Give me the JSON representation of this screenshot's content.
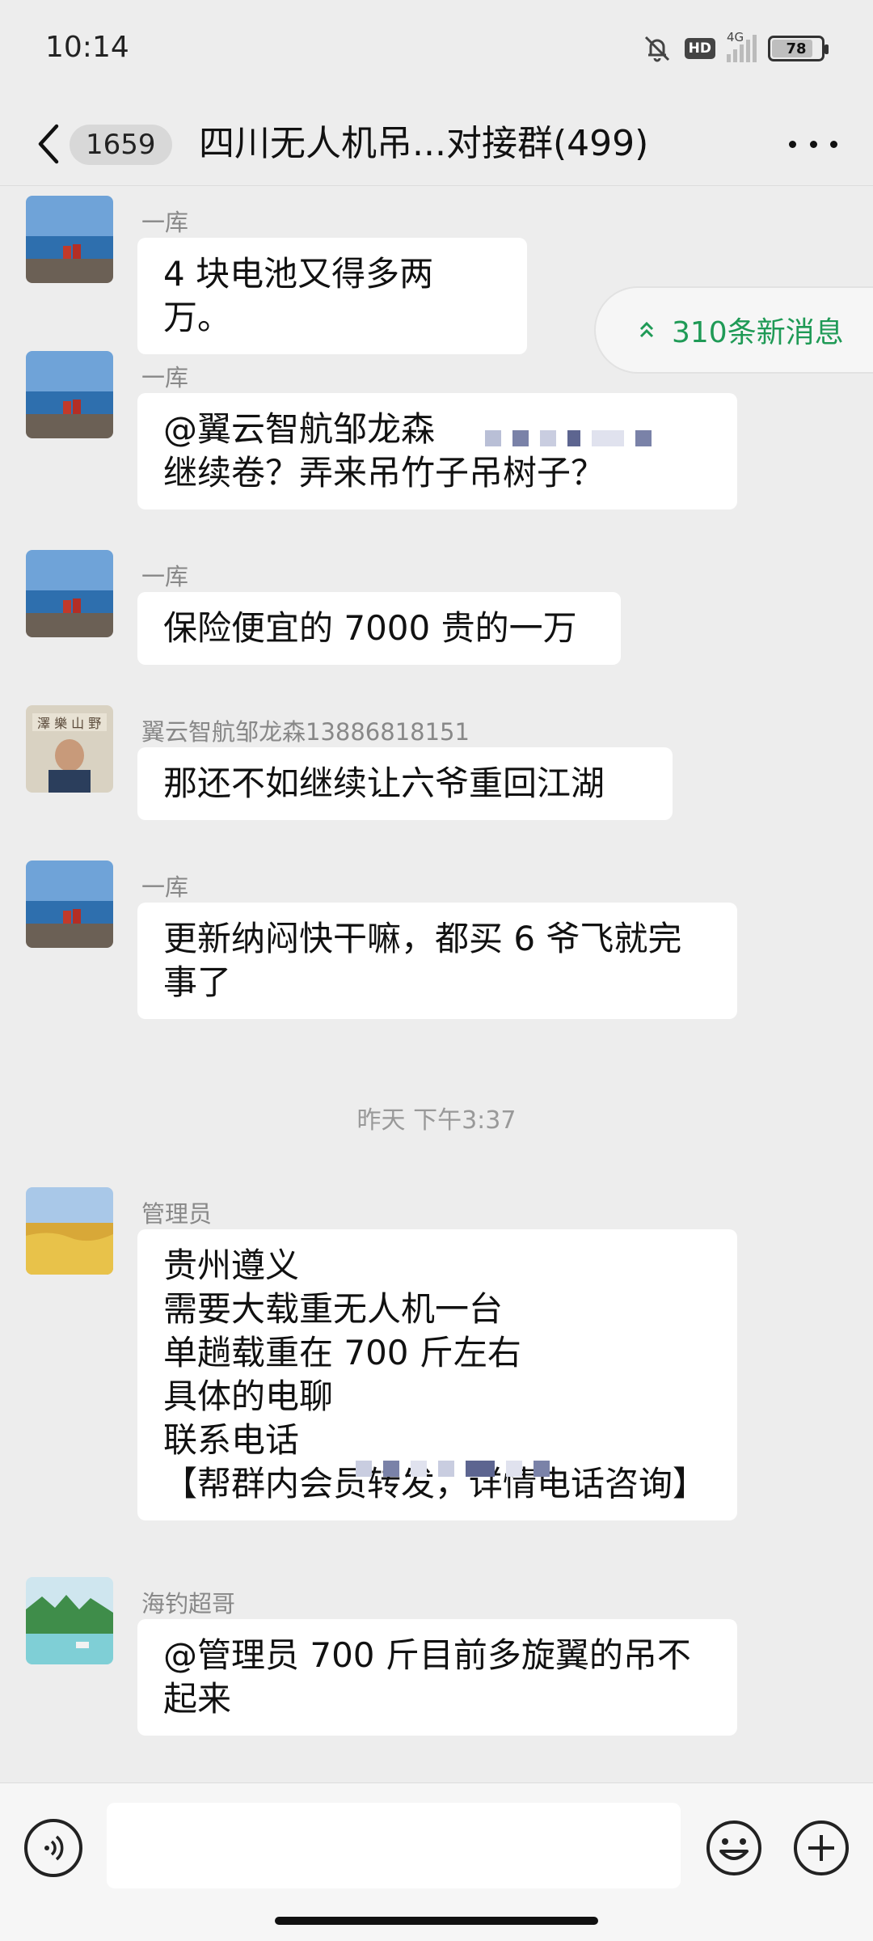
{
  "status": {
    "time": "10:14",
    "network": "4G",
    "battery": "78",
    "hd": "HD"
  },
  "nav": {
    "unread_count": "1659",
    "title": "四川无人机吊...对接群(499)"
  },
  "new_messages": "310条新消息",
  "time_separator": "昨天 下午3:37",
  "messages": [
    {
      "sender": "一库",
      "text": "4 块电池又得多两万。"
    },
    {
      "sender": "一库",
      "text": "@翼云智航邹龙森\n继续卷？弄来吊竹子吊树子？"
    },
    {
      "sender": "一库",
      "text": "保险便宜的 7000 贵的一万"
    },
    {
      "sender": "翼云智航邹龙森13886818151",
      "text": "那还不如继续让六爷重回江湖"
    },
    {
      "sender": "一库",
      "text": "更新纳闷快干嘛，都买 6 爷飞就完\n事了"
    },
    {
      "sender": "管理员",
      "text": "贵州遵义\n需要大载重无人机一台\n单趟载重在 700 斤左右\n具体的电聊\n联系电话\n【帮群内会员转发，详情电话咨询】"
    },
    {
      "sender": "海钓超哥",
      "text": "@管理员  700 斤目前多旋翼的吊不\n起来"
    }
  ],
  "colors": {
    "accent_green": "#1f9a56",
    "background": "#ededed",
    "bubble": "#ffffff"
  }
}
